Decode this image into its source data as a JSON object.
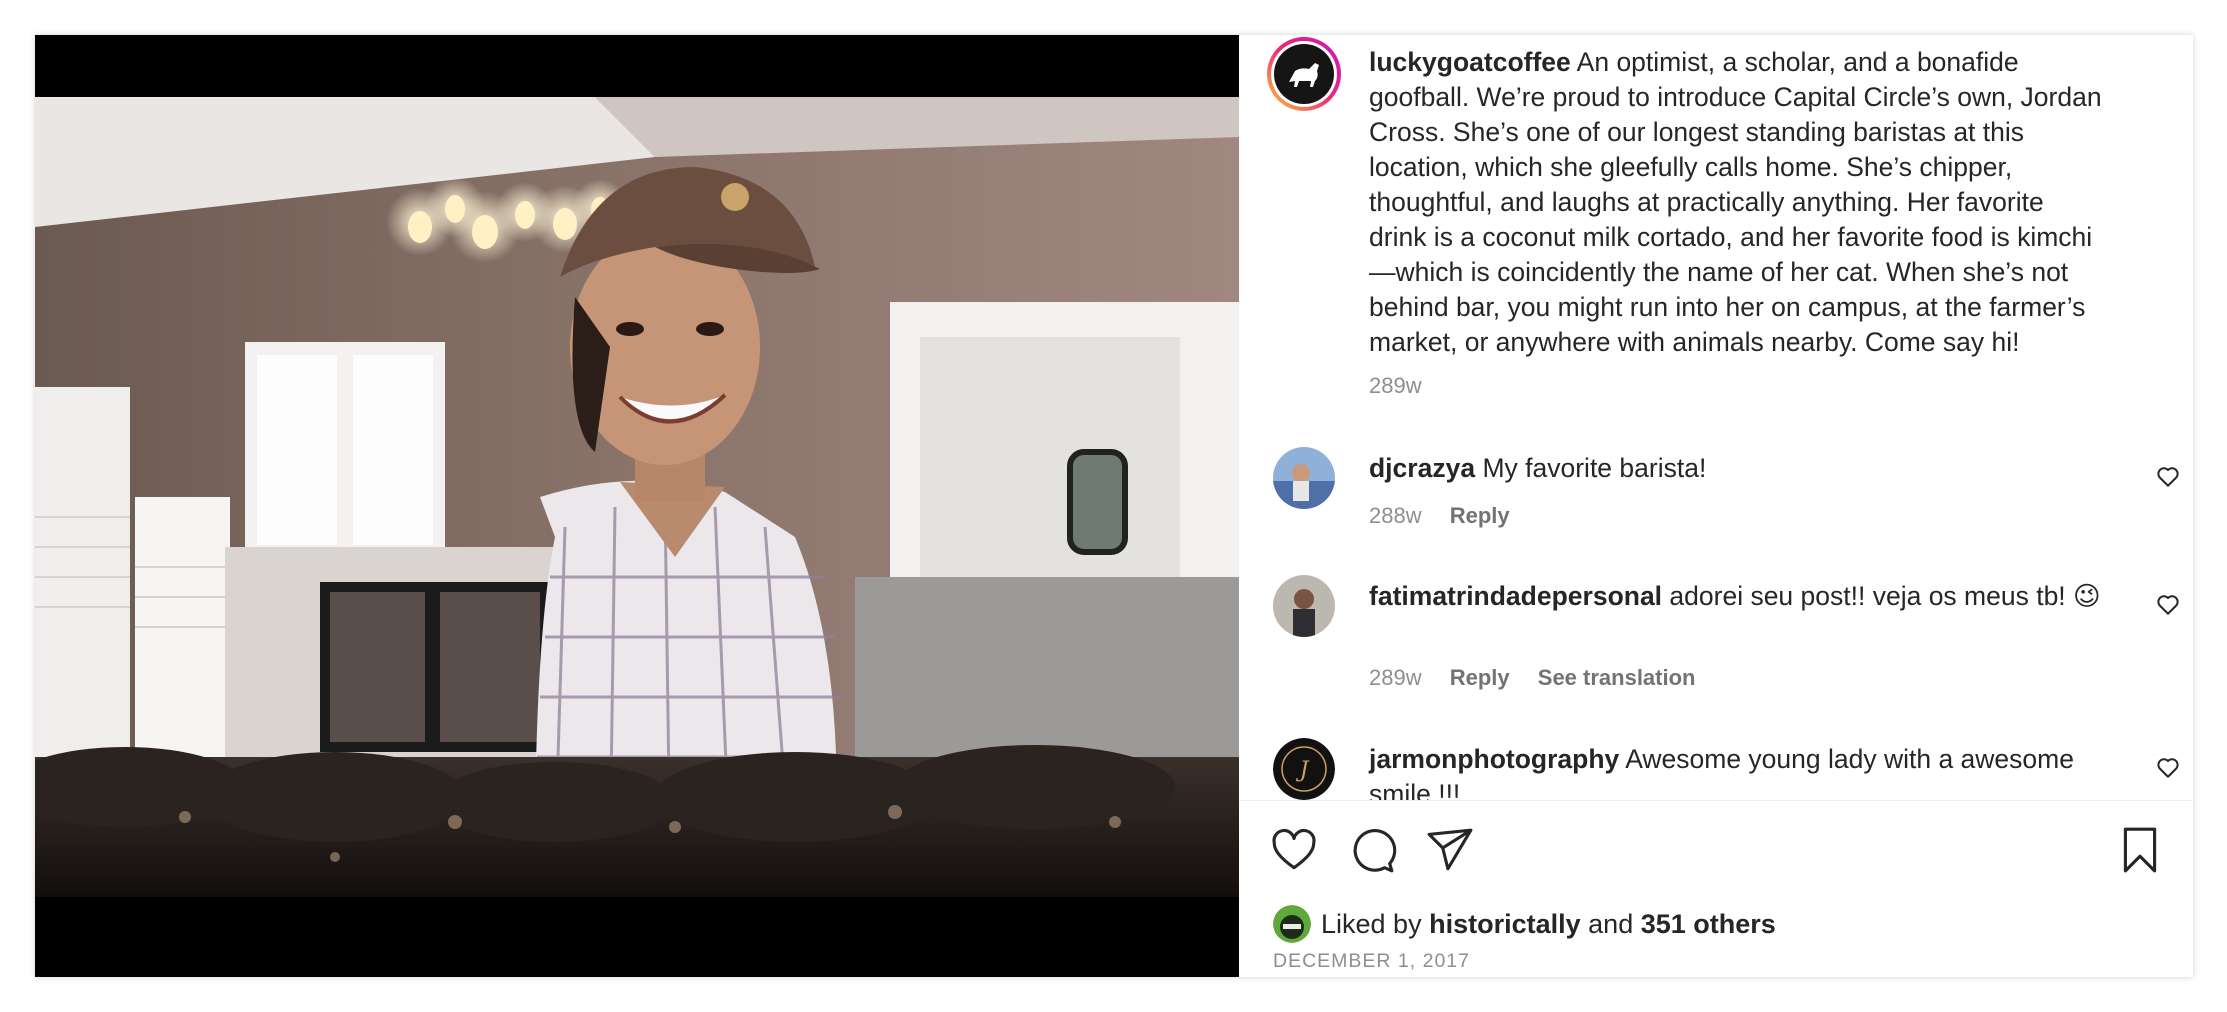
{
  "post": {
    "author": "luckygoatcoffee",
    "caption": "An optimist, a scholar, and a bonafide goofball. We’re proud to introduce Capital Circle’s own, Jordan Cross. She’s one of our longest standing baristas at this location, which she gleefully calls home. She’s chipper, thoughtful, and laughs at practically anything. Her favorite drink is a coconut milk cortado, and her favorite food is kimchi —which is coincidently the name of her cat. When she’s not behind bar, you might run into her on campus, at the farmer’s market, or anywhere with animals nearby. Come say hi!",
    "age": "289w"
  },
  "comments": [
    {
      "user": "djcrazya",
      "text": "My favorite barista!",
      "age": "288w",
      "reply": "Reply"
    },
    {
      "user": "fatimatrindadepersonal",
      "text": "adorei seu post!! veja os meus tb! 😉",
      "age": "289w",
      "reply": "Reply",
      "translate": "See translation"
    },
    {
      "user": "jarmonphotography",
      "text": "Awesome young lady with a awesome smile !!!"
    }
  ],
  "likes": {
    "prefix": "Liked by",
    "user": "historictally",
    "conjunction": "and",
    "others": "351 others"
  },
  "date": "DECEMBER 1, 2017",
  "colors": {
    "text": "#262626",
    "muted": "#8e8e8e",
    "story_ring_start": "#f9ce34",
    "story_ring_end": "#c913b9"
  },
  "icons": [
    "like-icon",
    "comment-icon",
    "share-icon",
    "bookmark-icon"
  ]
}
